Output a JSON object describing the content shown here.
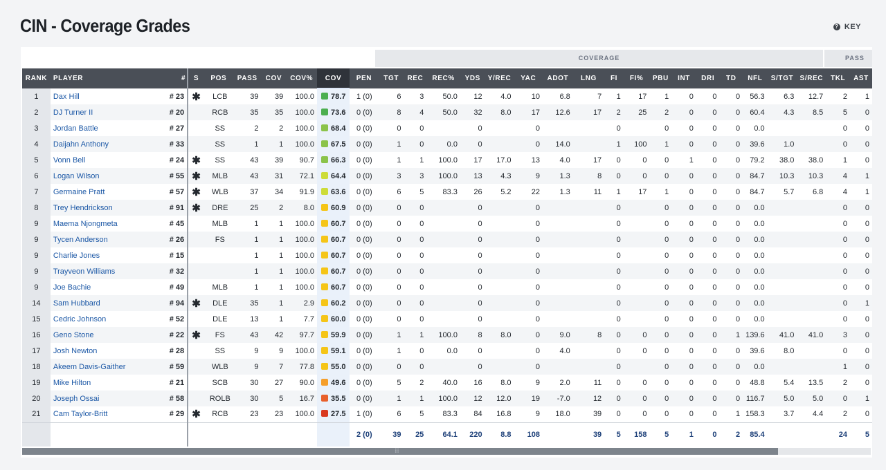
{
  "title": "CIN - Coverage Grades",
  "key_label": "KEY",
  "key_icon": "question-circle-icon",
  "group_headers": {
    "coverage": "COVERAGE",
    "pass": "PASS"
  },
  "columns": [
    "RANK",
    "PLAYER",
    "#",
    "S",
    "POS",
    "PASS",
    "COV",
    "COV%",
    "COV",
    "PEN",
    "TGT",
    "REC",
    "REC%",
    "YDS",
    "Y/REC",
    "YAC",
    "ADOT",
    "LNG",
    "FI",
    "FI%",
    "PBU",
    "INT",
    "DRI",
    "TD",
    "NFL",
    "S/TGT",
    "S/REC",
    "TKL",
    "AST"
  ],
  "grade_colors": {
    "green": "#4caf50",
    "lightgreen": "#8bc34a",
    "yellowgreen": "#cddc39",
    "yellow": "#f5c518",
    "orange": "#f59e2a",
    "redorange": "#e8602c",
    "red": "#d9391f"
  },
  "rows": [
    [
      "1",
      "Dax Hill",
      "# 23",
      "✱",
      "LCB",
      "39",
      "39",
      "100.0",
      "78.7",
      "1 (0)",
      "6",
      "3",
      "50.0",
      "12",
      "4.0",
      "10",
      "6.8",
      "7",
      "1",
      "17",
      "1",
      "0",
      "0",
      "0",
      "56.3",
      "6.3",
      "12.7",
      "2",
      "1"
    ],
    [
      "2",
      "DJ Turner II",
      "# 20",
      "",
      "RCB",
      "35",
      "35",
      "100.0",
      "73.6",
      "0 (0)",
      "8",
      "4",
      "50.0",
      "32",
      "8.0",
      "17",
      "12.6",
      "17",
      "2",
      "25",
      "2",
      "0",
      "0",
      "0",
      "60.4",
      "4.3",
      "8.5",
      "5",
      "0"
    ],
    [
      "3",
      "Jordan Battle",
      "# 27",
      "",
      "SS",
      "2",
      "2",
      "100.0",
      "68.4",
      "0 (0)",
      "0",
      "0",
      "",
      "0",
      "",
      "0",
      "",
      "",
      "0",
      "",
      "0",
      "0",
      "0",
      "0",
      "0.0",
      "",
      "",
      "0",
      "0"
    ],
    [
      "4",
      "Daijahn Anthony",
      "# 33",
      "",
      "SS",
      "1",
      "1",
      "100.0",
      "67.5",
      "0 (0)",
      "1",
      "0",
      "0.0",
      "0",
      "",
      "0",
      "14.0",
      "",
      "1",
      "100",
      "1",
      "0",
      "0",
      "0",
      "39.6",
      "1.0",
      "",
      "0",
      "0"
    ],
    [
      "5",
      "Vonn Bell",
      "# 24",
      "✱",
      "SS",
      "43",
      "39",
      "90.7",
      "66.3",
      "0 (0)",
      "1",
      "1",
      "100.0",
      "17",
      "17.0",
      "13",
      "4.0",
      "17",
      "0",
      "0",
      "0",
      "1",
      "0",
      "0",
      "79.2",
      "38.0",
      "38.0",
      "1",
      "0"
    ],
    [
      "6",
      "Logan Wilson",
      "# 55",
      "✱",
      "MLB",
      "43",
      "31",
      "72.1",
      "64.4",
      "0 (0)",
      "3",
      "3",
      "100.0",
      "13",
      "4.3",
      "9",
      "1.3",
      "8",
      "0",
      "0",
      "0",
      "0",
      "0",
      "0",
      "84.7",
      "10.3",
      "10.3",
      "4",
      "1"
    ],
    [
      "7",
      "Germaine Pratt",
      "# 57",
      "✱",
      "WLB",
      "37",
      "34",
      "91.9",
      "63.6",
      "0 (0)",
      "6",
      "5",
      "83.3",
      "26",
      "5.2",
      "22",
      "1.3",
      "11",
      "1",
      "17",
      "1",
      "0",
      "0",
      "0",
      "84.7",
      "5.7",
      "6.8",
      "4",
      "1"
    ],
    [
      "8",
      "Trey Hendrickson",
      "# 91",
      "✱",
      "DRE",
      "25",
      "2",
      "8.0",
      "60.9",
      "0 (0)",
      "0",
      "0",
      "",
      "0",
      "",
      "0",
      "",
      "",
      "0",
      "",
      "0",
      "0",
      "0",
      "0",
      "0.0",
      "",
      "",
      "0",
      "0"
    ],
    [
      "9",
      "Maema Njongmeta",
      "# 45",
      "",
      "MLB",
      "1",
      "1",
      "100.0",
      "60.7",
      "0 (0)",
      "0",
      "0",
      "",
      "0",
      "",
      "0",
      "",
      "",
      "0",
      "",
      "0",
      "0",
      "0",
      "0",
      "0.0",
      "",
      "",
      "0",
      "0"
    ],
    [
      "9",
      "Tycen Anderson",
      "# 26",
      "",
      "FS",
      "1",
      "1",
      "100.0",
      "60.7",
      "0 (0)",
      "0",
      "0",
      "",
      "0",
      "",
      "0",
      "",
      "",
      "0",
      "",
      "0",
      "0",
      "0",
      "0",
      "0.0",
      "",
      "",
      "0",
      "0"
    ],
    [
      "9",
      "Charlie Jones",
      "# 15",
      "",
      "",
      "1",
      "1",
      "100.0",
      "60.7",
      "0 (0)",
      "0",
      "0",
      "",
      "0",
      "",
      "0",
      "",
      "",
      "0",
      "",
      "0",
      "0",
      "0",
      "0",
      "0.0",
      "",
      "",
      "0",
      "0"
    ],
    [
      "9",
      "Trayveon Williams",
      "# 32",
      "",
      "",
      "1",
      "1",
      "100.0",
      "60.7",
      "0 (0)",
      "0",
      "0",
      "",
      "0",
      "",
      "0",
      "",
      "",
      "0",
      "",
      "0",
      "0",
      "0",
      "0",
      "0.0",
      "",
      "",
      "0",
      "0"
    ],
    [
      "9",
      "Joe Bachie",
      "# 49",
      "",
      "MLB",
      "1",
      "1",
      "100.0",
      "60.7",
      "0 (0)",
      "0",
      "0",
      "",
      "0",
      "",
      "0",
      "",
      "",
      "0",
      "",
      "0",
      "0",
      "0",
      "0",
      "0.0",
      "",
      "",
      "0",
      "0"
    ],
    [
      "14",
      "Sam Hubbard",
      "# 94",
      "✱",
      "DLE",
      "35",
      "1",
      "2.9",
      "60.2",
      "0 (0)",
      "0",
      "0",
      "",
      "0",
      "",
      "0",
      "",
      "",
      "0",
      "",
      "0",
      "0",
      "0",
      "0",
      "0.0",
      "",
      "",
      "0",
      "1"
    ],
    [
      "15",
      "Cedric Johnson",
      "# 52",
      "",
      "DLE",
      "13",
      "1",
      "7.7",
      "60.0",
      "0 (0)",
      "0",
      "0",
      "",
      "0",
      "",
      "0",
      "",
      "",
      "0",
      "",
      "0",
      "0",
      "0",
      "0",
      "0.0",
      "",
      "",
      "0",
      "0"
    ],
    [
      "16",
      "Geno Stone",
      "# 22",
      "✱",
      "FS",
      "43",
      "42",
      "97.7",
      "59.9",
      "0 (0)",
      "1",
      "1",
      "100.0",
      "8",
      "8.0",
      "0",
      "9.0",
      "8",
      "0",
      "0",
      "0",
      "0",
      "0",
      "1",
      "139.6",
      "41.0",
      "41.0",
      "3",
      "0"
    ],
    [
      "17",
      "Josh Newton",
      "# 28",
      "",
      "SS",
      "9",
      "9",
      "100.0",
      "59.1",
      "0 (0)",
      "1",
      "0",
      "0.0",
      "0",
      "",
      "0",
      "4.0",
      "",
      "0",
      "0",
      "0",
      "0",
      "0",
      "0",
      "39.6",
      "8.0",
      "",
      "0",
      "0"
    ],
    [
      "18",
      "Akeem Davis-Gaither",
      "# 59",
      "",
      "WLB",
      "9",
      "7",
      "77.8",
      "55.0",
      "0 (0)",
      "0",
      "0",
      "",
      "0",
      "",
      "0",
      "",
      "",
      "0",
      "",
      "0",
      "0",
      "0",
      "0",
      "0.0",
      "",
      "",
      "1",
      "0"
    ],
    [
      "19",
      "Mike Hilton",
      "# 21",
      "",
      "SCB",
      "30",
      "27",
      "90.0",
      "49.6",
      "0 (0)",
      "5",
      "2",
      "40.0",
      "16",
      "8.0",
      "9",
      "2.0",
      "11",
      "0",
      "0",
      "0",
      "0",
      "0",
      "0",
      "48.8",
      "5.4",
      "13.5",
      "2",
      "0"
    ],
    [
      "20",
      "Joseph Ossai",
      "# 58",
      "",
      "ROLB",
      "30",
      "5",
      "16.7",
      "35.5",
      "0 (0)",
      "1",
      "1",
      "100.0",
      "12",
      "12.0",
      "19",
      "-7.0",
      "12",
      "0",
      "0",
      "0",
      "0",
      "0",
      "0",
      "116.7",
      "5.0",
      "5.0",
      "0",
      "1"
    ],
    [
      "21",
      "Cam Taylor-Britt",
      "# 29",
      "✱",
      "RCB",
      "23",
      "23",
      "100.0",
      "27.5",
      "1 (0)",
      "6",
      "5",
      "83.3",
      "84",
      "16.8",
      "9",
      "18.0",
      "39",
      "0",
      "0",
      "0",
      "0",
      "0",
      "1",
      "158.3",
      "3.7",
      "4.4",
      "2",
      "0"
    ]
  ],
  "row_grade_colors": [
    "green",
    "green",
    "lightgreen",
    "lightgreen",
    "lightgreen",
    "yellowgreen",
    "yellowgreen",
    "yellow",
    "yellow",
    "yellow",
    "yellow",
    "yellow",
    "yellow",
    "yellow",
    "yellow",
    "yellow",
    "yellow",
    "yellow",
    "orange",
    "redorange",
    "red"
  ],
  "totals": [
    "",
    "",
    "",
    "",
    "",
    "",
    "",
    "",
    "",
    "2 (0)",
    "39",
    "25",
    "64.1",
    "220",
    "8.8",
    "108",
    "",
    "39",
    "5",
    "158",
    "5",
    "1",
    "0",
    "2",
    "85.4",
    "",
    "",
    "24",
    "5"
  ]
}
